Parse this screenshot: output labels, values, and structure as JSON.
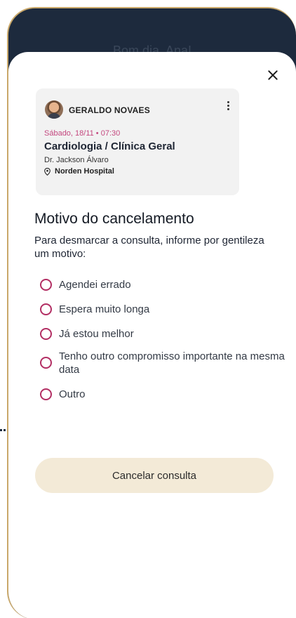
{
  "header": {
    "title": "Bom dia, Ana!"
  },
  "appointment_card": {
    "patient_name": "GERALDO NOVAES",
    "date_time": "Sábado, 18/11 • 07:30",
    "specialty": "Cardiologia / Clínica Geral",
    "doctor": "Dr. Jackson Álvaro",
    "hospital": "Norden Hospital"
  },
  "cancellation": {
    "title": "Motivo do cancelamento",
    "description": "Para desmarcar a consulta, informe por gentileza um motivo:",
    "options": [
      {
        "label": "Agendei errado",
        "selected": false
      },
      {
        "label": "Espera muito longa",
        "selected": false
      },
      {
        "label": "Já estou melhor",
        "selected": false
      },
      {
        "label": "Tenho outro compromisso importante na mesma data",
        "selected": false
      },
      {
        "label": "Outro",
        "selected": false
      }
    ],
    "button_label": "Cancelar consulta"
  },
  "colors": {
    "header_bg": "#1d2a3d",
    "accent": "#b22e63",
    "date_text": "#c4487f",
    "button_bg": "#f3ead7",
    "frame_border": "#c9a86a"
  },
  "icons": {
    "close": "close-icon",
    "menu": "kebab-menu-icon",
    "location": "location-pin-icon",
    "avatar": "avatar"
  }
}
